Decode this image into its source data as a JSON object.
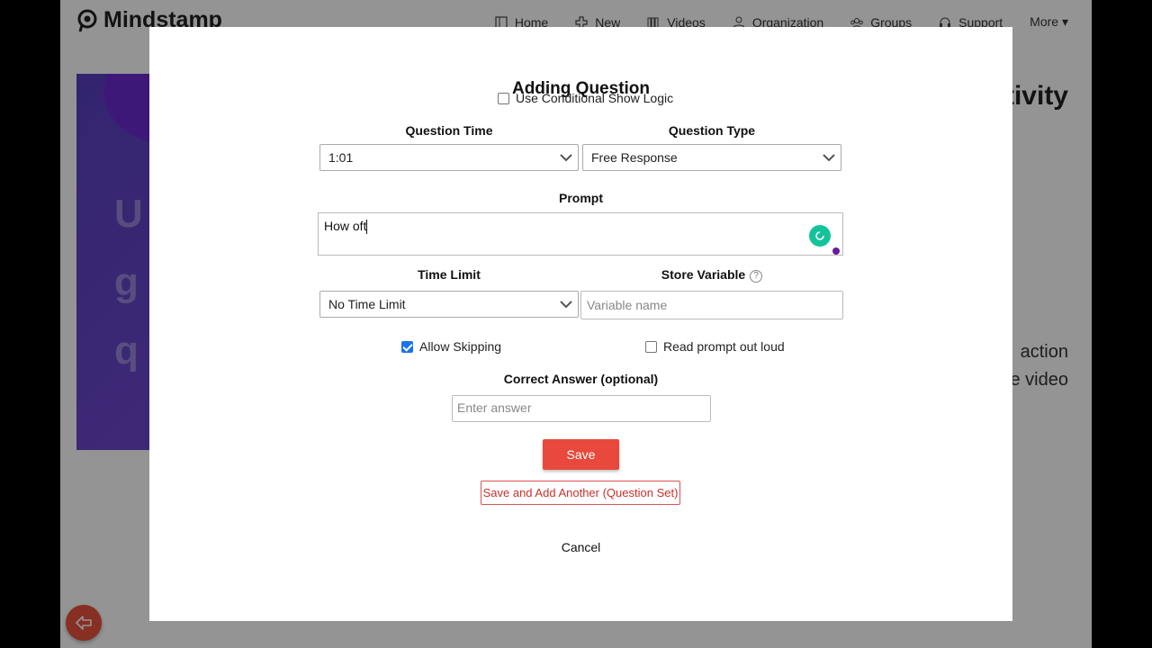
{
  "app": {
    "brand": "Mindstamp",
    "nav": [
      {
        "label": "Home",
        "icon": "home-icon"
      },
      {
        "label": "New",
        "icon": "plus-icon"
      },
      {
        "label": "Videos",
        "icon": "videos-icon"
      },
      {
        "label": "Organization",
        "icon": "user-icon"
      },
      {
        "label": "Groups",
        "icon": "groups-icon"
      },
      {
        "label": "Support",
        "icon": "headset-icon"
      },
      {
        "label": "More ▾",
        "icon": ""
      }
    ]
  },
  "background": {
    "hero_lines": [
      "U",
      "g",
      "q"
    ],
    "side_heading": "tivity",
    "side_text": [
      "action",
      "e video"
    ]
  },
  "modal": {
    "title": "Adding Question",
    "conditional_label": "Use Conditional Show Logic",
    "conditional_checked": false,
    "question_time_label": "Question Time",
    "question_time_value": "1:01",
    "question_type_label": "Question Type",
    "question_type_value": "Free Response",
    "prompt_label": "Prompt",
    "prompt_value": "How oft",
    "time_limit_label": "Time Limit",
    "time_limit_value": "No Time Limit",
    "store_variable_label": "Store Variable",
    "store_variable_help": "?",
    "variable_placeholder": "Variable name",
    "allow_skipping_label": "Allow Skipping",
    "allow_skipping_checked": true,
    "read_prompt_label": "Read prompt out loud",
    "read_prompt_checked": false,
    "correct_answer_label": "Correct Answer (optional)",
    "answer_placeholder": "Enter answer",
    "save_label": "Save",
    "save_add_label": "Save and Add Another (Question Set)",
    "cancel_label": "Cancel"
  },
  "colors": {
    "accent": "#e8493c",
    "checkbox": "#1a73e8",
    "grammarly": "#15c39a",
    "hero": "#6c4fd0"
  }
}
